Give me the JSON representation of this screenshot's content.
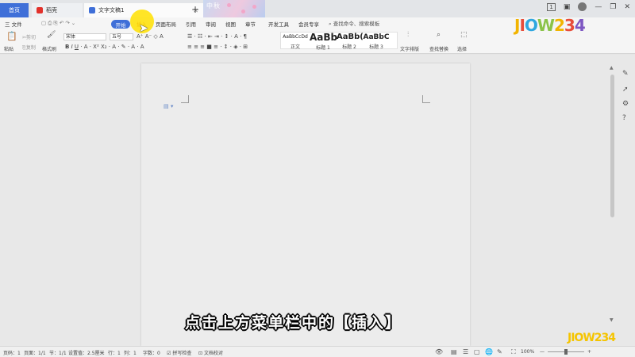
{
  "tabs": [
    {
      "label": "首页"
    },
    {
      "label": "稻壳"
    },
    {
      "label": "文字文稿1"
    }
  ],
  "banner_text": "中秋",
  "window": {
    "badge": "1"
  },
  "menu": {
    "file": "三 文件",
    "items": [
      "开始",
      "插入",
      "页面布局",
      "引用",
      "审阅",
      "视图",
      "章节",
      "开发工具",
      "会员专享"
    ],
    "search": "查找命令、搜索模板"
  },
  "ribbon": {
    "paste": "粘贴",
    "cut": "剪切",
    "copy": "复制",
    "format_painter": "格式刷",
    "font_name": "宋体",
    "font_size": "五号",
    "styles": [
      {
        "sample": "AaBbCcDd",
        "label": "正文"
      },
      {
        "sample": "AaBb",
        "label": "标题 1"
      },
      {
        "sample": "AaBb(",
        "label": "标题 2"
      },
      {
        "sample": "AaBbC",
        "label": "标题 3"
      }
    ],
    "text_layout": "文字排版",
    "find_replace": "查找替换",
    "select": "选择"
  },
  "logo": "JIOW234",
  "caption": "点击上方菜单栏中的【插入】",
  "status": {
    "page_num": "页码：1",
    "pages": "页面：1/1",
    "section": "节：1/1",
    "setting": "设置值：2.5厘米",
    "row": "行：1",
    "col": "列：1",
    "word_count": "字数：0",
    "spell": "拼写检查",
    "proof": "文档校对",
    "zoom": "100%"
  },
  "colors": {
    "accent": "#3f6fd8",
    "cursor_highlight": "#ffe100"
  }
}
